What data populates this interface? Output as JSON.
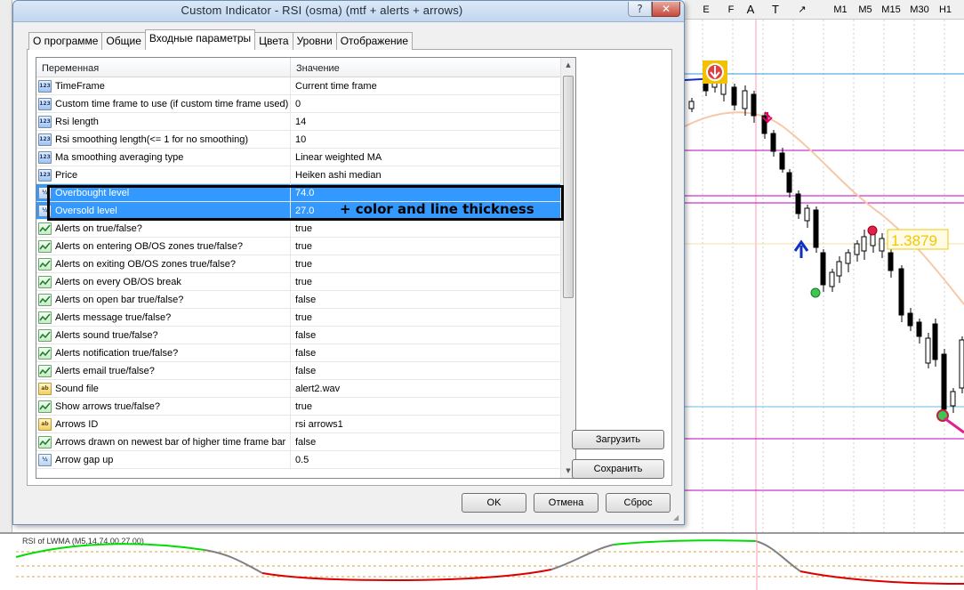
{
  "dialog": {
    "title": "Custom Indicator - RSI (osma) (mtf + alerts + arrows)",
    "help_label": "?",
    "close_label": "✕"
  },
  "tabs": [
    {
      "label": "О программе"
    },
    {
      "label": "Общие"
    },
    {
      "label": "Входные параметры",
      "active": true
    },
    {
      "label": "Цвета"
    },
    {
      "label": "Уровни"
    },
    {
      "label": "Отображение"
    }
  ],
  "grid": {
    "col_variable": "Переменная",
    "col_value": "Значение",
    "rows": [
      {
        "type": "int",
        "icon_text": "123",
        "name": "TimeFrame",
        "value": "Current time frame"
      },
      {
        "type": "int",
        "icon_text": "123",
        "name": "Custom time frame to use (if custom time frame used)",
        "value": "0"
      },
      {
        "type": "int",
        "icon_text": "123",
        "name": "Rsi length",
        "value": "14"
      },
      {
        "type": "int",
        "icon_text": "123",
        "name": "Rsi smoothing length(<= 1 for no smoothing)",
        "value": "10"
      },
      {
        "type": "int",
        "icon_text": "123",
        "name": "Ma smoothing averaging type",
        "value": "Linear weighted MA"
      },
      {
        "type": "int",
        "icon_text": "123",
        "name": "Price",
        "value": "Heiken ashi median"
      },
      {
        "type": "dbl",
        "icon_text": "½",
        "name": "Overbought level",
        "value": "74.0",
        "selected": true
      },
      {
        "type": "dbl",
        "icon_text": "½",
        "name": "Oversold level",
        "value": "27.0",
        "selected": true
      },
      {
        "type": "bool",
        "icon_text": "",
        "name": "Alerts on true/false?",
        "value": "true"
      },
      {
        "type": "bool",
        "icon_text": "",
        "name": "Alerts on entering OB/OS zones true/false?",
        "value": "true"
      },
      {
        "type": "bool",
        "icon_text": "",
        "name": "Alerts on exiting OB/OS zones true/false?",
        "value": "true"
      },
      {
        "type": "bool",
        "icon_text": "",
        "name": "Alerts on every OB/OS break",
        "value": "true"
      },
      {
        "type": "bool",
        "icon_text": "",
        "name": "Alerts on open bar true/false?",
        "value": "false"
      },
      {
        "type": "bool",
        "icon_text": "",
        "name": "Alerts message true/false?",
        "value": "true"
      },
      {
        "type": "bool",
        "icon_text": "",
        "name": "Alerts sound true/false?",
        "value": "false"
      },
      {
        "type": "bool",
        "icon_text": "",
        "name": "Alerts notification true/false?",
        "value": "false"
      },
      {
        "type": "bool",
        "icon_text": "",
        "name": "Alerts email true/false?",
        "value": "false"
      },
      {
        "type": "str",
        "icon_text": "ab",
        "name": "Sound file",
        "value": "alert2.wav"
      },
      {
        "type": "bool",
        "icon_text": "",
        "name": "Show arrows true/false?",
        "value": "true"
      },
      {
        "type": "str",
        "icon_text": "ab",
        "name": "Arrows ID",
        "value": "rsi arrows1"
      },
      {
        "type": "bool",
        "icon_text": "",
        "name": "Arrows drawn on newest bar of higher time frame bar",
        "value": "false"
      },
      {
        "type": "dbl",
        "icon_text": "½",
        "name": "Arrow gap up",
        "value": "0.5"
      }
    ]
  },
  "annotation": "+ color and line thickness",
  "buttons": {
    "load": "Загрузить",
    "save": "Сохранить",
    "ok": "OK",
    "cancel": "Отмена",
    "reset": "Сброс"
  },
  "toolbar": {
    "tools": [
      "E",
      "F",
      "A",
      "T",
      "↗"
    ],
    "timeframes": [
      "M1",
      "M5",
      "M15",
      "M30",
      "H1"
    ]
  },
  "chart": {
    "price_label": "1.3879",
    "rsi_label": "RSI of LWMA (M5,14,74.00,27.00)"
  },
  "colors": {
    "selection": "#3399ff",
    "price_label": "#f0c800",
    "rsi_up": "#00dd00",
    "rsi_down": "#dd0000",
    "rsi_neutral": "#808080",
    "level_lines": "#c000c0"
  }
}
